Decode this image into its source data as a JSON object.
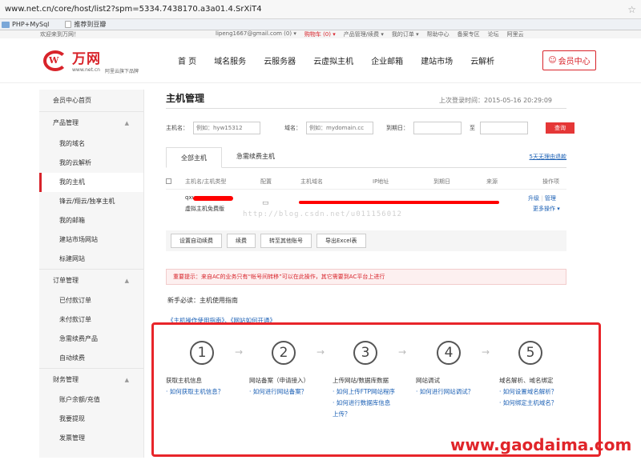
{
  "browser": {
    "url": "www.net.cn/core/host/list2?spm=5334.7438170.a3a01.4.SrXiT4",
    "bookmarks": [
      "PHP+MySql",
      "推荐到豆瓣"
    ]
  },
  "topbar": {
    "welcome": "欢迎来到万网！",
    "account": "lipeng1667@gmail.com (0) ▾",
    "cart": "购物车 (0) ▾",
    "product": "产品管理/续费 ▾",
    "orders": "我的订单 ▾",
    "help": "帮助中心",
    "beian": "备案专区",
    "forum": "论坛",
    "aliyun": "阿里云"
  },
  "header": {
    "logo_big": "万网",
    "logo_domain": "www.net.cn",
    "logo_sub": "阿里云旗下品牌",
    "nav": [
      "首 页",
      "域名服务",
      "云服务器",
      "云虚拟主机",
      "企业邮箱",
      "建站市场",
      "云解析"
    ],
    "member_center": "会员中心"
  },
  "sidebar": {
    "home": "会员中心首页",
    "product_group": "产品管理",
    "product_items": [
      "我的域名",
      "我的云解析",
      "我的主机",
      "锋云/翔云/独享主机",
      "我的邮箱",
      "建站市场网站",
      "标建网站"
    ],
    "order_group": "订单管理",
    "order_items": [
      "已付款订单",
      "未付款订单",
      "急需续费产品",
      "自动续费"
    ],
    "finance_group": "财务管理",
    "finance_items": [
      "账户余额/充值",
      "我要提现",
      "发票管理"
    ]
  },
  "main": {
    "title": "主机管理",
    "last_login": "上次登录时间：2015-05-16 20:29:09",
    "search": {
      "host_label": "主机名：",
      "host_placeholder": "例如：hyw15312",
      "domain_label": "域名：",
      "domain_placeholder": "例如：mydomain.cc",
      "expire_label": "到期日：",
      "to_label": "至",
      "query": "查询"
    },
    "tabs": [
      "全部主机",
      "急需续费主机"
    ],
    "renew_link": "5天无理由退款",
    "columns": [
      "主机名/主机类型",
      "配置",
      "主机域名",
      "IP地址",
      "到期日",
      "来源",
      "操作项"
    ],
    "row": {
      "name": "qxu",
      "type": "虚拟主机免费版",
      "upgrade": "升级",
      "manage": "管理",
      "more": "更多操作 ▾"
    },
    "watermark": "http://blog.csdn.net/u011156012",
    "bulk_buttons": [
      "设置自动续费",
      "续费",
      "转至其他账号",
      "导出Excel表"
    ],
    "notice": "重要提示：来自AC的业务只有“帐号间转移”可以在此操作，其它需要到AC平台上进行",
    "guide_title": "新手必读：主机使用指南",
    "guide_links": "《主机操作使用指南》、《网站如何开通》",
    "steps": [
      {
        "num": "1",
        "title": "获取主机信息",
        "links": [
          "· 如何获取主机信息？"
        ]
      },
      {
        "num": "2",
        "title": "网站备案（申请接入）",
        "links": [
          "· 如何进行网站备案？"
        ]
      },
      {
        "num": "3",
        "title": "上传网站/数据库数据",
        "links": [
          "· 如何上传FTP网站程序",
          "· 如何进行数据库信息",
          "上传？"
        ]
      },
      {
        "num": "4",
        "title": "网站调试",
        "links": [
          "· 如何进行网站调试？"
        ]
      },
      {
        "num": "5",
        "title": "域名解析、域名绑定",
        "links": [
          "· 如何设置域名解析？",
          "· 如何绑定主机域名？"
        ]
      }
    ],
    "arrow": "→"
  },
  "site_watermark": "www.gaodaima.com"
}
